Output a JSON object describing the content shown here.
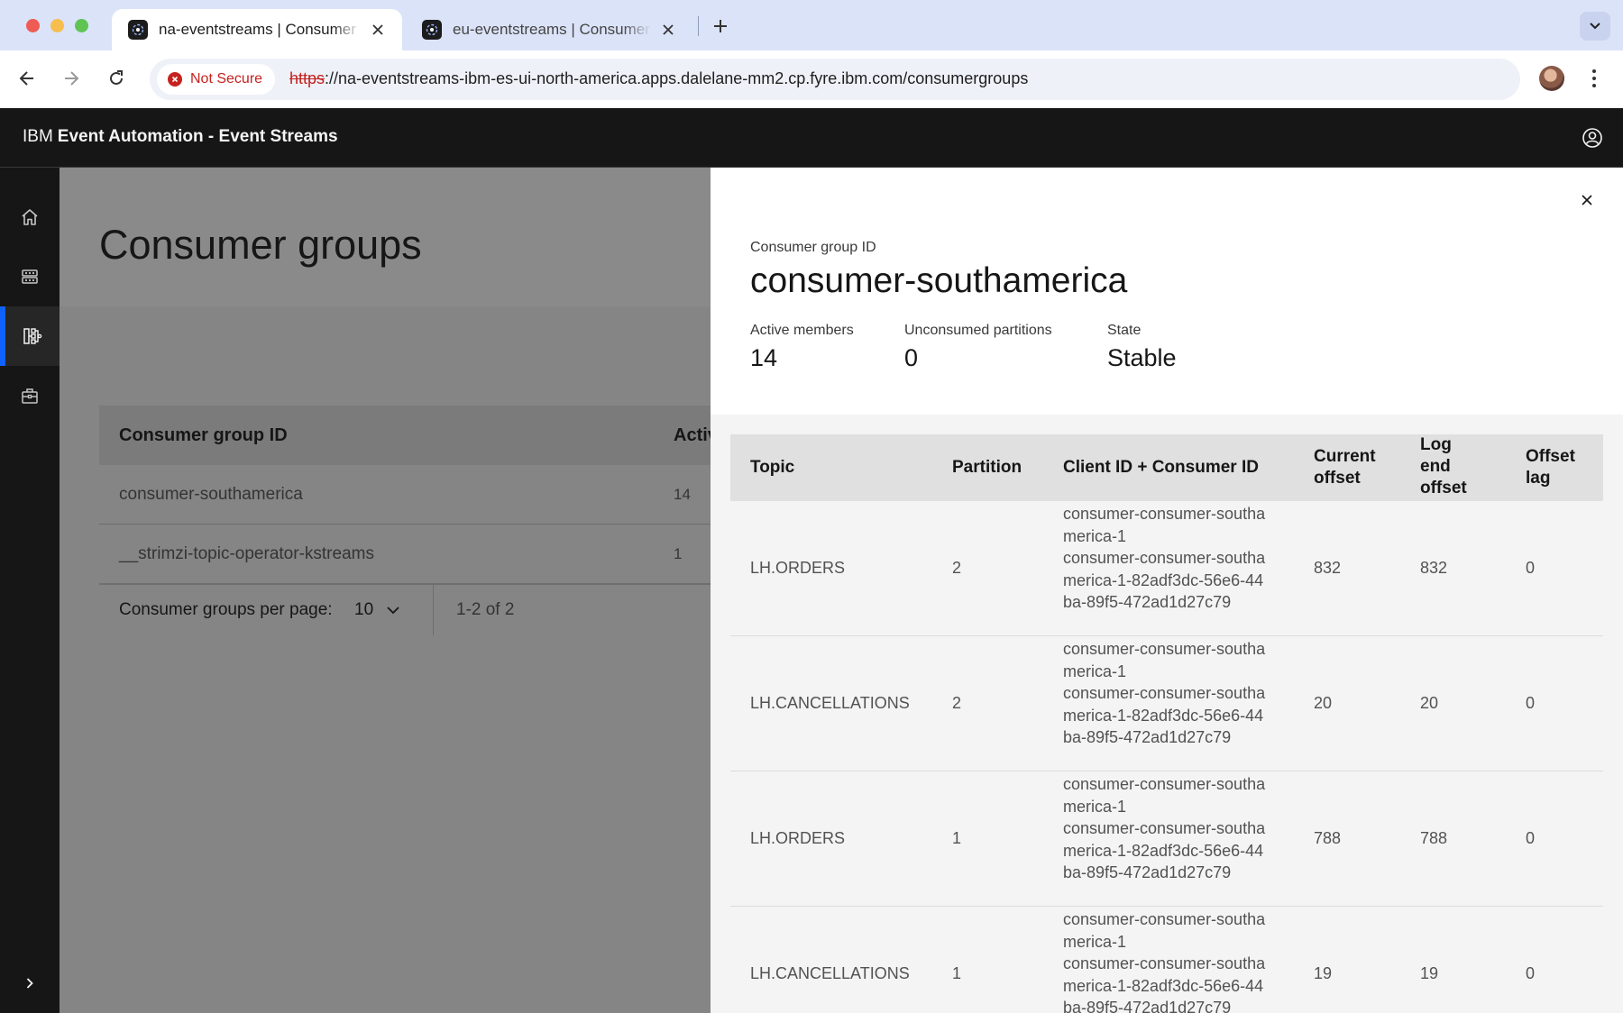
{
  "browser": {
    "tabs": [
      {
        "title": "na-eventstreams | Consumer groups",
        "active": true
      },
      {
        "title": "eu-eventstreams | Consumer groups",
        "active": false
      }
    ],
    "security_label": "Not Secure",
    "url_scheme": "https",
    "url_rest": "://na-eventstreams-ibm-es-ui-north-america.apps.dalelane-mm2.cp.fyre.ibm.com/consumergroups",
    "warning_color": "#c5221f"
  },
  "app": {
    "brand_ibm": "IBM",
    "brand_product": "Event Automation - Event Streams",
    "accent_color": "#0f62fe"
  },
  "sidenav": {
    "items": [
      {
        "icon": "home-icon",
        "selected": false
      },
      {
        "icon": "topics-icon",
        "selected": false
      },
      {
        "icon": "consumer-groups-icon",
        "selected": true
      },
      {
        "icon": "toolbox-icon",
        "selected": false
      }
    ],
    "expand_icon": "chevron-right-icon"
  },
  "main": {
    "page_title": "Consumer groups",
    "table": {
      "columns": [
        "Consumer group ID",
        "Activ"
      ],
      "rows": [
        {
          "id": "consumer-southamerica",
          "active": "14"
        },
        {
          "id": "__strimzi-topic-operator-kstreams",
          "active": "1"
        }
      ]
    },
    "pagination": {
      "per_page_label": "Consumer groups per page:",
      "per_page_value": "10",
      "range": "1-2 of 2"
    }
  },
  "panel": {
    "group_id_label": "Consumer group ID",
    "group_id": "consumer-southamerica",
    "stats": [
      {
        "label": "Active members",
        "value": "14"
      },
      {
        "label": "Unconsumed partitions",
        "value": "0"
      },
      {
        "label": "State",
        "value": "Stable"
      }
    ],
    "table": {
      "columns": [
        "Topic",
        "Partition",
        "Client ID + Consumer ID",
        "Current offset",
        "Log end offset",
        "Offset lag"
      ],
      "rows": [
        {
          "topic": "LH.ORDERS",
          "partition": "2",
          "client_id": "consumer-consumer-southamerica-1",
          "consumer_id": "consumer-consumer-southamerica-1-82adf3dc-56e6-44ba-89f5-472ad1d27c79",
          "current_offset": "832",
          "log_end_offset": "832",
          "offset_lag": "0"
        },
        {
          "topic": "LH.CANCELLATIONS",
          "partition": "2",
          "client_id": "consumer-consumer-southamerica-1",
          "consumer_id": "consumer-consumer-southamerica-1-82adf3dc-56e6-44ba-89f5-472ad1d27c79",
          "current_offset": "20",
          "log_end_offset": "20",
          "offset_lag": "0"
        },
        {
          "topic": "LH.ORDERS",
          "partition": "1",
          "client_id": "consumer-consumer-southamerica-1",
          "consumer_id": "consumer-consumer-southamerica-1-82adf3dc-56e6-44ba-89f5-472ad1d27c79",
          "current_offset": "788",
          "log_end_offset": "788",
          "offset_lag": "0"
        },
        {
          "topic": "LH.CANCELLATIONS",
          "partition": "1",
          "client_id": "consumer-consumer-southamerica-1",
          "consumer_id": "consumer-consumer-southamerica-1-82adf3dc-56e6-44ba-89f5-472ad1d27c79",
          "current_offset": "19",
          "log_end_offset": "19",
          "offset_lag": "0"
        }
      ]
    }
  }
}
